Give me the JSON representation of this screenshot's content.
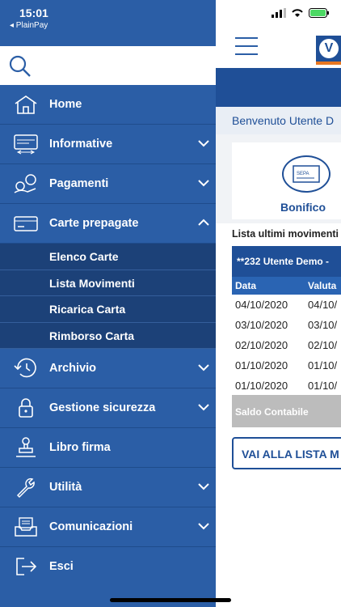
{
  "status_bar": {
    "time": "15:01",
    "back_app": "◂ PlainPay"
  },
  "search": {
    "placeholder": ""
  },
  "menu": {
    "items": [
      {
        "label": "Home",
        "icon": "home-icon"
      },
      {
        "label": "Informative",
        "icon": "info-card-icon"
      },
      {
        "label": "Pagamenti",
        "icon": "payments-icon"
      },
      {
        "label": "Carte prepagate",
        "icon": "card-icon"
      },
      {
        "label": "Archivio",
        "icon": "history-icon"
      },
      {
        "label": "Gestione sicurezza",
        "icon": "lock-icon"
      },
      {
        "label": "Libro firma",
        "icon": "stamp-icon"
      },
      {
        "label": "Utilità",
        "icon": "wrench-icon"
      },
      {
        "label": "Comunicazioni",
        "icon": "inbox-icon"
      },
      {
        "label": "Esci",
        "icon": "logout-icon"
      }
    ],
    "carte_sub": [
      "Elenco Carte",
      "Lista Movimenti",
      "Ricarica Carta",
      "Rimborso Carta"
    ]
  },
  "background": {
    "welcome": "Benvenuto Utente D",
    "bonifico_label": "Bonifico",
    "sepa_label": "SEPA",
    "lista_title": "Lista ultimi movimenti",
    "account": "**232 Utente Demo -",
    "table_headers": [
      "Data",
      "Valuta"
    ],
    "rows": [
      [
        "04/10/2020",
        "04/10/"
      ],
      [
        "03/10/2020",
        "03/10/"
      ],
      [
        "02/10/2020",
        "02/10/"
      ],
      [
        "01/10/2020",
        "01/10/"
      ],
      [
        "01/10/2020",
        "01/10/"
      ]
    ],
    "saldo": "Saldo Contabile",
    "vai_button": "VAI ALLA LISTA M"
  },
  "colors": {
    "drawer": "#2b5ea6",
    "sub": "#1c4178",
    "brand": "#1f4f97",
    "accent": "#e87722"
  }
}
